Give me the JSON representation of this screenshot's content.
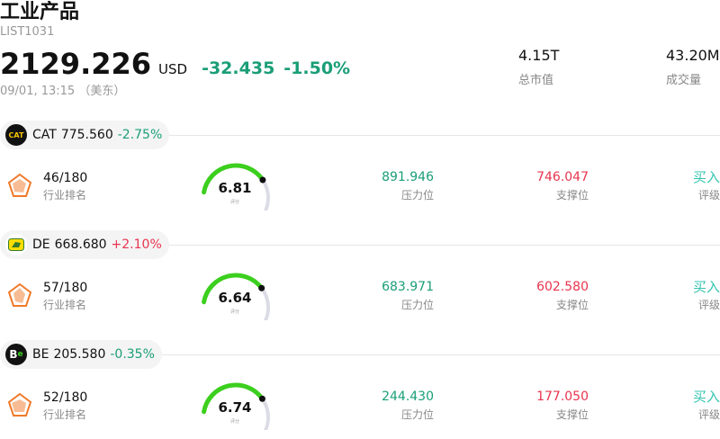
{
  "header": {
    "title": "工业产品",
    "list_id": "LIST1031",
    "price": "2129.226",
    "currency": "USD",
    "change": "-32.435",
    "change_pct": "-1.50%",
    "timestamp": "09/01, 13:15 （美东）"
  },
  "stats": {
    "market_cap": {
      "value": "4.15T",
      "label": "总市值"
    },
    "volume": {
      "value": "43.20M",
      "label": "成交量"
    }
  },
  "stocks": [
    {
      "ticker": "CAT",
      "price": "775.560",
      "change": "-2.75%",
      "direction": "down",
      "logo_icon": "caterpillar-logo",
      "rank": "46/180",
      "rank_label": "行业排名",
      "score": "6.81",
      "score_value": 6.81,
      "score_label": "评分",
      "resistance": "891.946",
      "resistance_label": "压力位",
      "support": "746.047",
      "support_label": "支撑位",
      "rating": "买入",
      "rating_label": "评级"
    },
    {
      "ticker": "DE",
      "price": "668.680",
      "change": "+2.10%",
      "direction": "up",
      "logo_icon": "john-deere-logo",
      "rank": "57/180",
      "rank_label": "行业排名",
      "score": "6.64",
      "score_value": 6.64,
      "score_label": "评分",
      "resistance": "683.971",
      "resistance_label": "压力位",
      "support": "602.580",
      "support_label": "支撑位",
      "rating": "买入",
      "rating_label": "评级"
    },
    {
      "ticker": "BE",
      "price": "205.580",
      "change": "-0.35%",
      "direction": "down",
      "logo_icon": "bloom-energy-logo",
      "rank": "52/180",
      "rank_label": "行业排名",
      "score": "6.74",
      "score_value": 6.74,
      "score_label": "评分",
      "resistance": "244.430",
      "resistance_label": "压力位",
      "support": "177.050",
      "support_label": "支撑位",
      "rating": "买入",
      "rating_label": "评级"
    }
  ],
  "colors": {
    "down": "#1a9e77",
    "up": "#e8344e",
    "gauge_fill": "#3ccf1e",
    "gauge_track": "#dcdce6",
    "rating": "#35c4b0",
    "rank_icon": "#f07a2a"
  }
}
